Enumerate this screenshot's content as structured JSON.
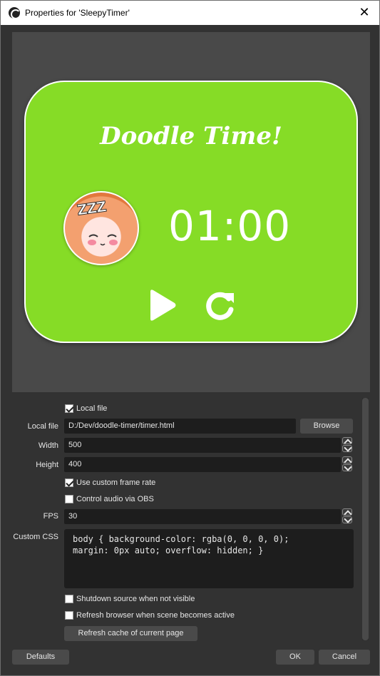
{
  "window": {
    "title": "Properties for 'SleepyTimer'"
  },
  "preview": {
    "heading": "Doodle Time!",
    "time": "01:00",
    "avatar_text": "ZZZ",
    "card_color": "#86dc26"
  },
  "form": {
    "local_file_checkbox": {
      "label": "Local file",
      "checked": true
    },
    "local_file": {
      "label": "Local file",
      "value": "D:/Dev/doodle-timer/timer.html",
      "browse_label": "Browse"
    },
    "width": {
      "label": "Width",
      "value": "500"
    },
    "height": {
      "label": "Height",
      "value": "400"
    },
    "custom_frame_rate": {
      "label": "Use custom frame rate",
      "checked": true
    },
    "control_audio": {
      "label": "Control audio via OBS",
      "checked": false
    },
    "fps": {
      "label": "FPS",
      "value": "30"
    },
    "custom_css": {
      "label": "Custom CSS",
      "value": "body { background-color: rgba(0, 0, 0, 0);\nmargin: 0px auto; overflow: hidden; }"
    },
    "shutdown_hidden": {
      "label": "Shutdown source when not visible",
      "checked": false
    },
    "refresh_active": {
      "label": "Refresh browser when scene becomes active",
      "checked": false
    },
    "refresh_cache_label": "Refresh cache of current page"
  },
  "footer": {
    "defaults_label": "Defaults",
    "ok_label": "OK",
    "cancel_label": "Cancel"
  }
}
